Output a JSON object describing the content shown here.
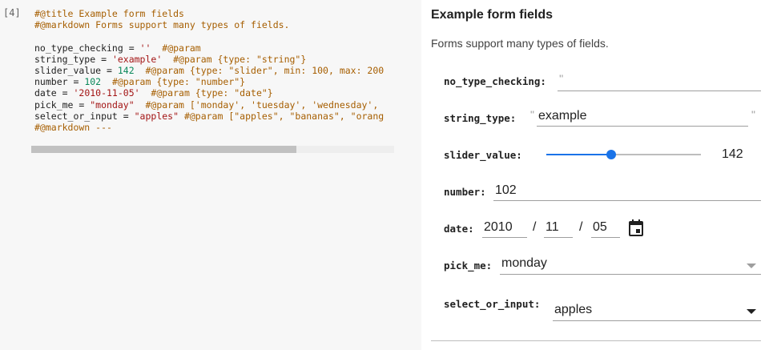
{
  "cell": {
    "execution_count": "[4]",
    "code_lines": [
      [
        {
          "t": "#@title Example form fields",
          "c": "comment"
        }
      ],
      [
        {
          "t": "#@markdown Forms support many types of fields.",
          "c": "comment"
        }
      ],
      [
        {
          "t": "",
          "c": "plain"
        }
      ],
      [
        {
          "t": "no_type_checking = ",
          "c": "plain"
        },
        {
          "t": "''",
          "c": "str"
        },
        {
          "t": "  #@param",
          "c": "comment"
        }
      ],
      [
        {
          "t": "string_type = ",
          "c": "plain"
        },
        {
          "t": "'example'",
          "c": "str"
        },
        {
          "t": "  #@param {type: \"string\"}",
          "c": "comment"
        }
      ],
      [
        {
          "t": "slider_value = ",
          "c": "plain"
        },
        {
          "t": "142",
          "c": "num"
        },
        {
          "t": "  #@param {type: \"slider\", min: 100, max: 200",
          "c": "comment"
        }
      ],
      [
        {
          "t": "number = ",
          "c": "plain"
        },
        {
          "t": "102",
          "c": "num"
        },
        {
          "t": "  #@param {type: \"number\"}",
          "c": "comment"
        }
      ],
      [
        {
          "t": "date = ",
          "c": "plain"
        },
        {
          "t": "'2010-11-05'",
          "c": "str"
        },
        {
          "t": "  #@param {type: \"date\"}",
          "c": "comment"
        }
      ],
      [
        {
          "t": "pick_me = ",
          "c": "plain"
        },
        {
          "t": "\"monday\"",
          "c": "str"
        },
        {
          "t": "  #@param ['monday', 'tuesday', 'wednesday',",
          "c": "comment"
        }
      ],
      [
        {
          "t": "select_or_input = ",
          "c": "plain"
        },
        {
          "t": "\"apples\"",
          "c": "str"
        },
        {
          "t": " #@param [\"apples\", \"bananas\", \"orang",
          "c": "comment"
        }
      ],
      [
        {
          "t": "#@markdown ---",
          "c": "comment"
        }
      ]
    ],
    "scroll_fraction": 0.73
  },
  "form": {
    "title": "Example form fields",
    "description": "Forms support many types of fields.",
    "fields": {
      "no_type_checking": {
        "label": "no_type_checking:",
        "quote": "''",
        "value": ""
      },
      "string_type": {
        "label": "string_type:",
        "open_quote": "\"",
        "close_quote": "\"",
        "value": "example"
      },
      "slider_value": {
        "label": "slider_value:",
        "value": "142",
        "min": 100,
        "max": 200,
        "fraction": 0.42
      },
      "number": {
        "label": "number:",
        "value": "102"
      },
      "date": {
        "label": "date:",
        "year": "2010",
        "month": "11",
        "day": "05",
        "sep": "/"
      },
      "pick_me": {
        "label": "pick_me:",
        "value": "monday"
      },
      "select_or_input": {
        "label": "select_or_input:",
        "value": "apples"
      }
    }
  },
  "colors": {
    "accent": "#1a73e8",
    "comment": "#a65e00",
    "string": "#a31515",
    "number": "#09885a"
  },
  "icons": {
    "calendar": "calendar-icon",
    "dropdown": "chevron-down-icon"
  }
}
